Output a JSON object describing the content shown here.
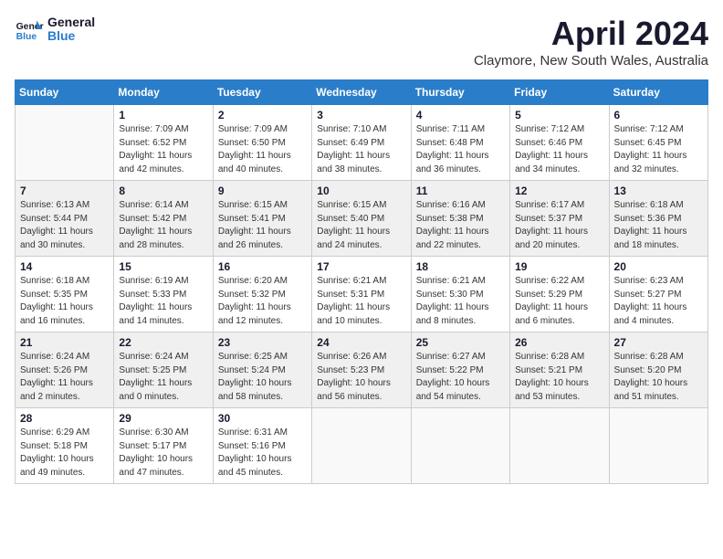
{
  "logo": {
    "line1": "General",
    "line2": "Blue"
  },
  "title": "April 2024",
  "subtitle": "Claymore, New South Wales, Australia",
  "days_of_week": [
    "Sunday",
    "Monday",
    "Tuesday",
    "Wednesday",
    "Thursday",
    "Friday",
    "Saturday"
  ],
  "weeks": [
    [
      {
        "day": "",
        "info": ""
      },
      {
        "day": "1",
        "info": "Sunrise: 7:09 AM\nSunset: 6:52 PM\nDaylight: 11 hours\nand 42 minutes."
      },
      {
        "day": "2",
        "info": "Sunrise: 7:09 AM\nSunset: 6:50 PM\nDaylight: 11 hours\nand 40 minutes."
      },
      {
        "day": "3",
        "info": "Sunrise: 7:10 AM\nSunset: 6:49 PM\nDaylight: 11 hours\nand 38 minutes."
      },
      {
        "day": "4",
        "info": "Sunrise: 7:11 AM\nSunset: 6:48 PM\nDaylight: 11 hours\nand 36 minutes."
      },
      {
        "day": "5",
        "info": "Sunrise: 7:12 AM\nSunset: 6:46 PM\nDaylight: 11 hours\nand 34 minutes."
      },
      {
        "day": "6",
        "info": "Sunrise: 7:12 AM\nSunset: 6:45 PM\nDaylight: 11 hours\nand 32 minutes."
      }
    ],
    [
      {
        "day": "7",
        "info": "Sunrise: 6:13 AM\nSunset: 5:44 PM\nDaylight: 11 hours\nand 30 minutes."
      },
      {
        "day": "8",
        "info": "Sunrise: 6:14 AM\nSunset: 5:42 PM\nDaylight: 11 hours\nand 28 minutes."
      },
      {
        "day": "9",
        "info": "Sunrise: 6:15 AM\nSunset: 5:41 PM\nDaylight: 11 hours\nand 26 minutes."
      },
      {
        "day": "10",
        "info": "Sunrise: 6:15 AM\nSunset: 5:40 PM\nDaylight: 11 hours\nand 24 minutes."
      },
      {
        "day": "11",
        "info": "Sunrise: 6:16 AM\nSunset: 5:38 PM\nDaylight: 11 hours\nand 22 minutes."
      },
      {
        "day": "12",
        "info": "Sunrise: 6:17 AM\nSunset: 5:37 PM\nDaylight: 11 hours\nand 20 minutes."
      },
      {
        "day": "13",
        "info": "Sunrise: 6:18 AM\nSunset: 5:36 PM\nDaylight: 11 hours\nand 18 minutes."
      }
    ],
    [
      {
        "day": "14",
        "info": "Sunrise: 6:18 AM\nSunset: 5:35 PM\nDaylight: 11 hours\nand 16 minutes."
      },
      {
        "day": "15",
        "info": "Sunrise: 6:19 AM\nSunset: 5:33 PM\nDaylight: 11 hours\nand 14 minutes."
      },
      {
        "day": "16",
        "info": "Sunrise: 6:20 AM\nSunset: 5:32 PM\nDaylight: 11 hours\nand 12 minutes."
      },
      {
        "day": "17",
        "info": "Sunrise: 6:21 AM\nSunset: 5:31 PM\nDaylight: 11 hours\nand 10 minutes."
      },
      {
        "day": "18",
        "info": "Sunrise: 6:21 AM\nSunset: 5:30 PM\nDaylight: 11 hours\nand 8 minutes."
      },
      {
        "day": "19",
        "info": "Sunrise: 6:22 AM\nSunset: 5:29 PM\nDaylight: 11 hours\nand 6 minutes."
      },
      {
        "day": "20",
        "info": "Sunrise: 6:23 AM\nSunset: 5:27 PM\nDaylight: 11 hours\nand 4 minutes."
      }
    ],
    [
      {
        "day": "21",
        "info": "Sunrise: 6:24 AM\nSunset: 5:26 PM\nDaylight: 11 hours\nand 2 minutes."
      },
      {
        "day": "22",
        "info": "Sunrise: 6:24 AM\nSunset: 5:25 PM\nDaylight: 11 hours\nand 0 minutes."
      },
      {
        "day": "23",
        "info": "Sunrise: 6:25 AM\nSunset: 5:24 PM\nDaylight: 10 hours\nand 58 minutes."
      },
      {
        "day": "24",
        "info": "Sunrise: 6:26 AM\nSunset: 5:23 PM\nDaylight: 10 hours\nand 56 minutes."
      },
      {
        "day": "25",
        "info": "Sunrise: 6:27 AM\nSunset: 5:22 PM\nDaylight: 10 hours\nand 54 minutes."
      },
      {
        "day": "26",
        "info": "Sunrise: 6:28 AM\nSunset: 5:21 PM\nDaylight: 10 hours\nand 53 minutes."
      },
      {
        "day": "27",
        "info": "Sunrise: 6:28 AM\nSunset: 5:20 PM\nDaylight: 10 hours\nand 51 minutes."
      }
    ],
    [
      {
        "day": "28",
        "info": "Sunrise: 6:29 AM\nSunset: 5:18 PM\nDaylight: 10 hours\nand 49 minutes."
      },
      {
        "day": "29",
        "info": "Sunrise: 6:30 AM\nSunset: 5:17 PM\nDaylight: 10 hours\nand 47 minutes."
      },
      {
        "day": "30",
        "info": "Sunrise: 6:31 AM\nSunset: 5:16 PM\nDaylight: 10 hours\nand 45 minutes."
      },
      {
        "day": "",
        "info": ""
      },
      {
        "day": "",
        "info": ""
      },
      {
        "day": "",
        "info": ""
      },
      {
        "day": "",
        "info": ""
      }
    ]
  ]
}
